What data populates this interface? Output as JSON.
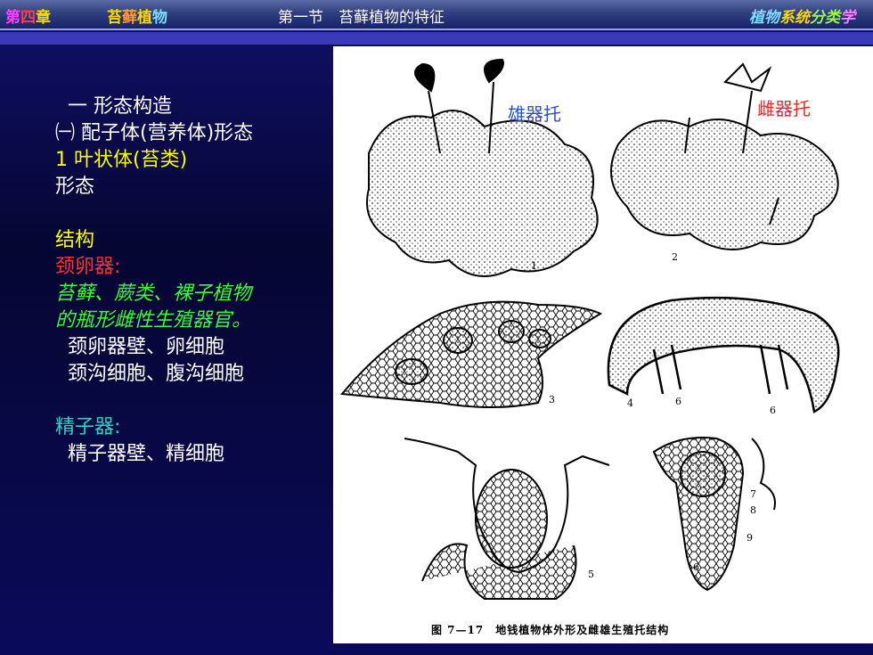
{
  "header": {
    "chapter": [
      "第",
      "四",
      "章"
    ],
    "subject": [
      "苔",
      "藓",
      "植",
      "物"
    ],
    "section": "第一节　苔藓植物的特征",
    "course": [
      "植物",
      "系统",
      "分类",
      "学"
    ]
  },
  "content": {
    "line1": "一 形态构造",
    "line2": "㈠ 配子体(营养体)形态",
    "line3": "1 叶状体(苔类)",
    "line4": "形态",
    "line5": "结构",
    "line6": "颈卵器:",
    "line7": "苔藓、蕨类、裸子植物",
    "line8": "的瓶形雌性生殖器官。",
    "line9": "颈卵器壁、卵细胞",
    "line10": "颈沟细胞、腹沟细胞",
    "line11": "精子器:",
    "line12": "精子器壁、精细胞"
  },
  "figure": {
    "label_male": "雄器托",
    "label_female": "雌器托",
    "caption": "图 7—17　地钱植物体外形及雌雄生殖托结构",
    "numbers": [
      "1",
      "2",
      "3",
      "4",
      "6",
      "6",
      "5",
      "6",
      "7",
      "8",
      "9"
    ]
  }
}
